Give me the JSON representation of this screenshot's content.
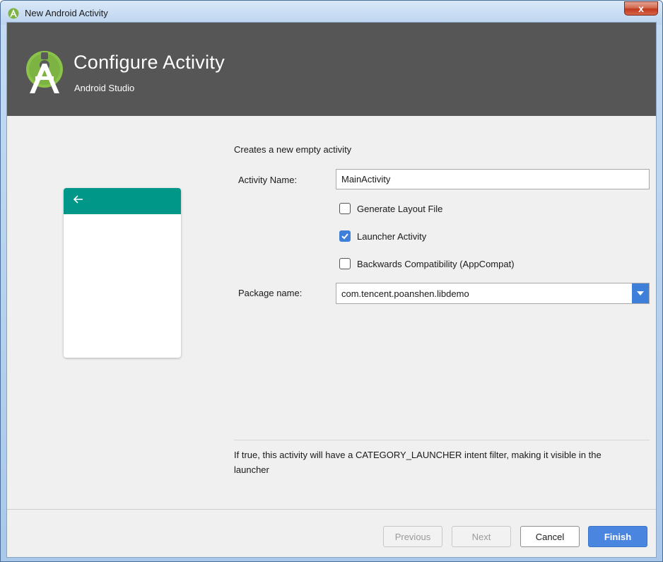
{
  "window": {
    "title": "New Android Activity",
    "close_glyph": "x"
  },
  "header": {
    "title": "Configure Activity",
    "subtitle": "Android Studio",
    "icon": "android-studio-logo-icon",
    "background": "#565656"
  },
  "preview": {
    "toolbar_color": "#009688",
    "back_icon": "arrow-back-icon"
  },
  "form": {
    "description": "Creates a new empty activity",
    "activity_name_label": "Activity Name:",
    "activity_name_value": "MainActivity",
    "generate_layout_label": "Generate Layout File",
    "generate_layout_checked": false,
    "launcher_label": "Launcher Activity",
    "launcher_checked": true,
    "backwards_label": "Backwards Compatibility (AppCompat)",
    "backwards_checked": false,
    "package_label": "Package name:",
    "package_value": "com.tencent.poanshen.libdemo"
  },
  "hint": {
    "text": "If true, this activity will have a CATEGORY_LAUNCHER intent filter, making it visible in the launcher"
  },
  "buttons": {
    "previous": "Previous",
    "next": "Next",
    "cancel": "Cancel",
    "finish": "Finish"
  },
  "colors": {
    "accent": "#3d7fd9",
    "finish_button": "#4a86e0"
  }
}
